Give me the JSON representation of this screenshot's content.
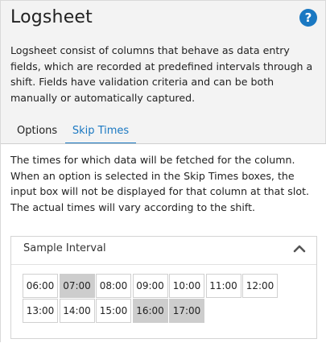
{
  "header": {
    "title": "Logsheet",
    "help_label": "?"
  },
  "description": "Logsheet consist of columns that behave as data entry fields, which are recorded at predefined intervals through a shift. Fields have validation criteria and can be both manually or automatically captured.",
  "tabs": [
    {
      "label": "Options",
      "active": false
    },
    {
      "label": "Skip Times",
      "active": true
    }
  ],
  "skip_times": {
    "description": "The times for which data will be fetched for the column. When an option is selected in the Skip Times boxes, the input box will not be displayed for that column at that slot. The actual times will vary according to the shift.",
    "section_title": "Sample Interval",
    "collapse_icon": "chevron-up-icon",
    "times": [
      {
        "label": "06:00",
        "selected": false
      },
      {
        "label": "07:00",
        "selected": true
      },
      {
        "label": "08:00",
        "selected": false
      },
      {
        "label": "09:00",
        "selected": false
      },
      {
        "label": "10:00",
        "selected": false
      },
      {
        "label": "11:00",
        "selected": false
      },
      {
        "label": "12:00",
        "selected": false
      },
      {
        "label": "13:00",
        "selected": false
      },
      {
        "label": "14:00",
        "selected": false
      },
      {
        "label": "15:00",
        "selected": false
      },
      {
        "label": "16:00",
        "selected": true
      },
      {
        "label": "17:00",
        "selected": true
      }
    ]
  },
  "colors": {
    "accent": "#1a78c2",
    "selected_cell": "#cdcdcd"
  }
}
